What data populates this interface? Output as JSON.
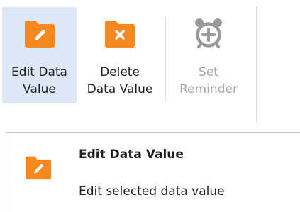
{
  "ribbon": {
    "buttons": [
      {
        "id": "edit",
        "label": "Edit Data\nValue",
        "icon": "folder-edit-icon",
        "state": "hover"
      },
      {
        "id": "delete",
        "label": "Delete\nData Value",
        "icon": "folder-delete-icon",
        "state": "normal"
      },
      {
        "id": "reminder",
        "label": "Set\nReminder",
        "icon": "alarm-clock-add-icon",
        "state": "disabled"
      }
    ]
  },
  "tooltip": {
    "title": "Edit Data Value",
    "description": "Edit selected data value",
    "icon": "folder-edit-icon"
  },
  "colors": {
    "folder": "#f5891f",
    "hover_bg": "#dce8f6",
    "disabled": "#a6a6a6"
  }
}
